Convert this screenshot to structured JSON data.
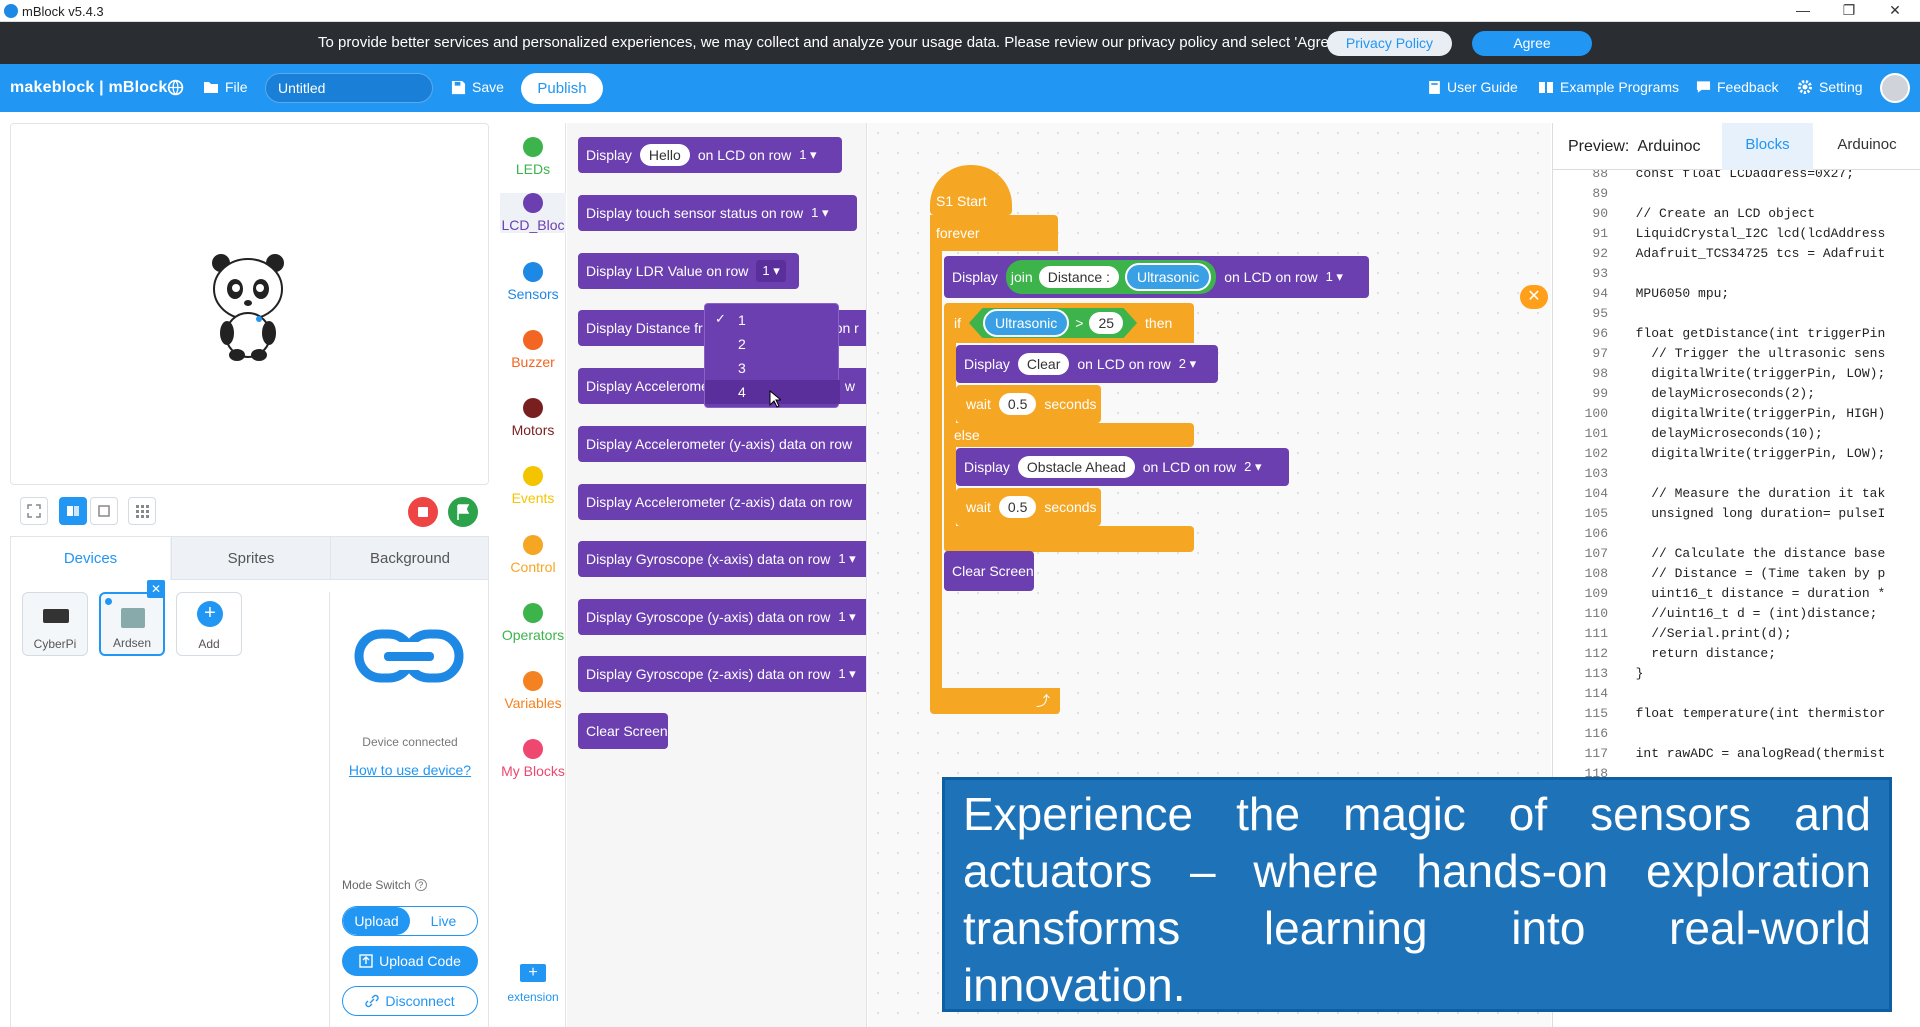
{
  "window": {
    "title": "mBlock v5.4.3",
    "minimize": "—",
    "restore": "❐",
    "close": "✕"
  },
  "privacy": {
    "message": "To provide better services and personalized experiences, we may collect and analyze your usage data. Please review our privacy policy and select 'Agree'.",
    "policy_label": "Privacy Policy",
    "agree_label": "Agree"
  },
  "menu": {
    "logo": "makeblock | mBlock",
    "file": "File",
    "project_name": "Untitled",
    "save": "Save",
    "publish": "Publish",
    "user_guide": "User Guide",
    "examples": "Example Programs",
    "feedback": "Feedback",
    "setting": "Setting"
  },
  "devices": {
    "tabs": [
      "Devices",
      "Sprites",
      "Background"
    ],
    "cards": [
      "CyberPi",
      "Ardsen",
      "Add"
    ],
    "status": "Device connected",
    "how_to": "How to use device?",
    "mode_switch": "Mode Switch",
    "upload": "Upload",
    "live": "Live",
    "upload_code": "Upload Code",
    "disconnect": "Disconnect"
  },
  "categories": [
    {
      "label": "LEDs",
      "color": "#3cb44b"
    },
    {
      "label": "LCD_Bloc",
      "color": "#6b3fb0"
    },
    {
      "label": "Sensors",
      "color": "#1e88e5"
    },
    {
      "label": "Buzzer",
      "color": "#f26522"
    },
    {
      "label": "Motors",
      "color": "#7a1f1f"
    },
    {
      "label": "Events",
      "color": "#f5c400"
    },
    {
      "label": "Control",
      "color": "#f5a623"
    },
    {
      "label": "Operators",
      "color": "#3cb44b"
    },
    {
      "label": "Variables",
      "color": "#f58220"
    },
    {
      "label": "My Blocks",
      "color": "#ef476f"
    }
  ],
  "extension": "extension",
  "palette": {
    "b1_display": "Display",
    "b1_value": "Hello",
    "b1_suffix": "on LCD on row",
    "b1_row": "1 ▾",
    "b2": "Display touch sensor status on row",
    "b2_row": "1 ▾",
    "b3": "Display LDR Value on row",
    "b3_row": "1 ▾",
    "b4": "Display Distance fr",
    "b4_tail": "on r",
    "b5": "Display Acceleromet",
    "b5_tail": "w",
    "b6": "Display Accelerometer (y-axis) data on row",
    "b7": "Display Accelerometer (z-axis) data on row",
    "b8": "Display Gyroscope (x-axis) data on row",
    "b8_row": "1 ▾",
    "b9": "Display Gyroscope (y-axis) data on row",
    "b9_row": "1 ▾",
    "b10": "Display Gyroscope (z-axis) data on row",
    "b10_row": "1 ▾",
    "b11": "Clear Screen"
  },
  "dropdown": {
    "options": [
      "1",
      "2",
      "3",
      "4"
    ],
    "checked": "✓"
  },
  "script": {
    "hat": "S1 Start",
    "forever": "forever",
    "display": "Display",
    "join": "join",
    "distance": "Distance :",
    "ultrasonic": "Ultrasonic",
    "on_lcd": "on LCD on row",
    "row1": "1 ▾",
    "if": "if",
    "gt": ">",
    "threshold": "25",
    "then": "then",
    "clear": "Clear",
    "row2": "2 ▾",
    "wait": "wait",
    "wait_val": "0.5",
    "seconds": "seconds",
    "else": "else",
    "obstacle": "Obstacle Ahead",
    "clear_screen": "Clear Screen",
    "loop_arrow": "⤴",
    "close": "✕"
  },
  "preview": {
    "title": "Preview:",
    "device": "Arduinoc",
    "tab_blocks": "Blocks",
    "tab_code": "Arduinoc",
    "lines": [
      {
        "n": "88",
        "t": "  const float LCDaddress=0x27;"
      },
      {
        "n": "89",
        "t": ""
      },
      {
        "n": "90",
        "t": "  // Create an LCD object"
      },
      {
        "n": "91",
        "t": "  LiquidCrystal_I2C lcd(lcdAddress"
      },
      {
        "n": "92",
        "t": "  Adafruit_TCS34725 tcs = Adafruit"
      },
      {
        "n": "93",
        "t": ""
      },
      {
        "n": "94",
        "t": "  MPU6050 mpu;"
      },
      {
        "n": "95",
        "t": ""
      },
      {
        "n": "96",
        "t": "  float getDistance(int triggerPin"
      },
      {
        "n": "97",
        "t": "    // Trigger the ultrasonic sens"
      },
      {
        "n": "98",
        "t": "    digitalWrite(triggerPin, LOW);"
      },
      {
        "n": "99",
        "t": "    delayMicroseconds(2);"
      },
      {
        "n": "100",
        "t": "    digitalWrite(triggerPin, HIGH)"
      },
      {
        "n": "101",
        "t": "    delayMicroseconds(10);"
      },
      {
        "n": "102",
        "t": "    digitalWrite(triggerPin, LOW);"
      },
      {
        "n": "103",
        "t": ""
      },
      {
        "n": "104",
        "t": "    // Measure the duration it tak"
      },
      {
        "n": "105",
        "t": "    unsigned long duration= pulseI"
      },
      {
        "n": "106",
        "t": ""
      },
      {
        "n": "107",
        "t": "    // Calculate the distance base"
      },
      {
        "n": "108",
        "t": "    // Distance = (Time taken by p"
      },
      {
        "n": "109",
        "t": "    uint16_t distance = duration *"
      },
      {
        "n": "110",
        "t": "    //uint16_t d = (int)distance;"
      },
      {
        "n": "111",
        "t": "    //Serial.print(d);"
      },
      {
        "n": "112",
        "t": "    return distance;"
      },
      {
        "n": "113",
        "t": "  }"
      },
      {
        "n": "114",
        "t": ""
      },
      {
        "n": "115",
        "t": "  float temperature(int thermistor"
      },
      {
        "n": "116",
        "t": ""
      },
      {
        "n": "117",
        "t": "  int rawADC = analogRead(thermist"
      },
      {
        "n": "118",
        "t": ""
      }
    ]
  },
  "caption": "Experience the magic of sensors and actuators – where hands-on exploration transforms learning into real-world innovation."
}
